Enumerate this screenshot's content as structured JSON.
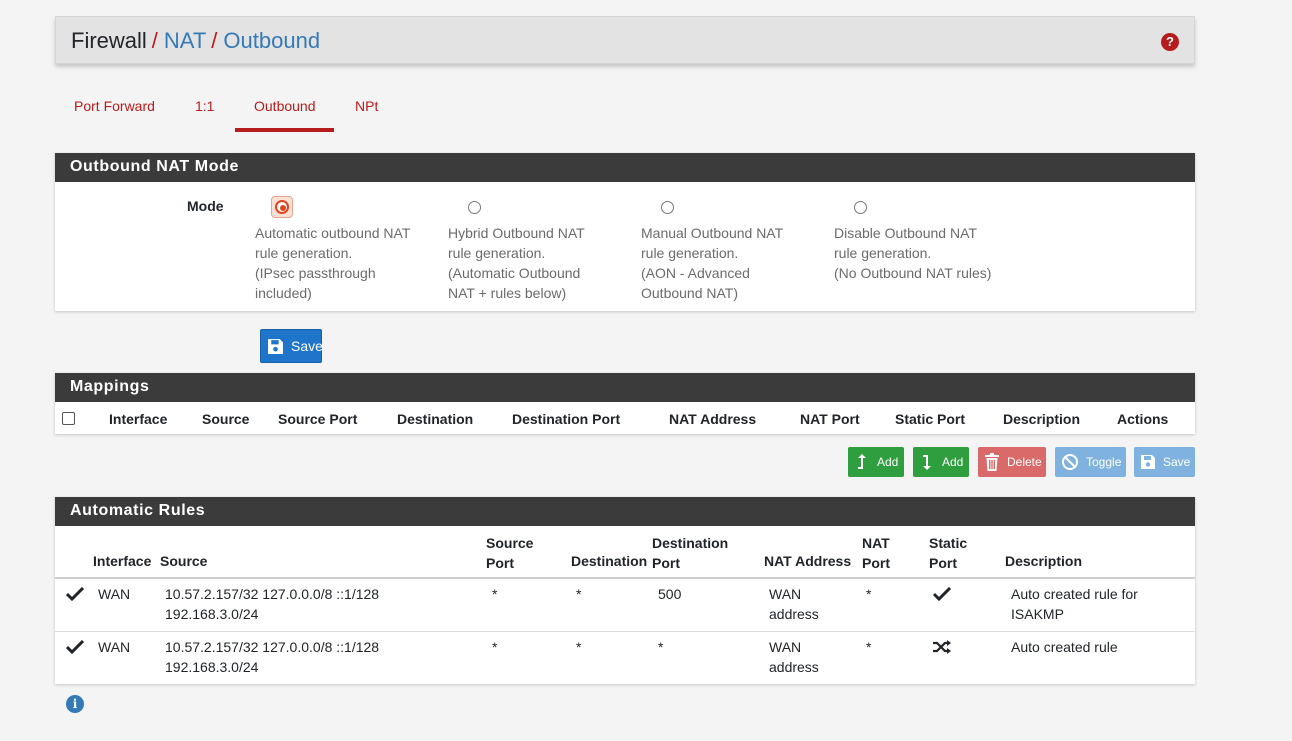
{
  "breadcrumb": {
    "items": [
      "Firewall",
      "NAT",
      "Outbound"
    ],
    "separator": "/",
    "help_icon": "question-circle-icon"
  },
  "tabs": [
    {
      "label": "Port Forward",
      "active": false
    },
    {
      "label": "1:1",
      "active": false
    },
    {
      "label": "Outbound",
      "active": true
    },
    {
      "label": "NPt",
      "active": false
    }
  ],
  "mode_panel": {
    "title": "Outbound NAT Mode",
    "field_label": "Mode",
    "options": [
      {
        "lines": [
          "Automatic outbound NAT",
          "rule generation.",
          "(IPsec passthrough",
          "included)"
        ],
        "selected": true
      },
      {
        "lines": [
          "Hybrid Outbound NAT",
          "rule generation.",
          "(Automatic Outbound",
          "NAT + rules below)"
        ],
        "selected": false
      },
      {
        "lines": [
          "Manual Outbound NAT",
          "rule generation.",
          "(AON - Advanced",
          "Outbound NAT)"
        ],
        "selected": false
      },
      {
        "lines": [
          "Disable Outbound NAT",
          "rule generation.",
          "(No Outbound NAT rules)"
        ],
        "selected": false
      }
    ],
    "save_label": "Save"
  },
  "mappings": {
    "title": "Mappings",
    "columns": [
      "Interface",
      "Source",
      "Source Port",
      "Destination",
      "Destination Port",
      "NAT Address",
      "NAT Port",
      "Static Port",
      "Description",
      "Actions"
    ],
    "buttons": {
      "add_top": "Add",
      "add_bottom": "Add",
      "delete": "Delete",
      "toggle": "Toggle",
      "save": "Save"
    }
  },
  "automatic_rules": {
    "title": "Automatic Rules",
    "columns": {
      "interface": "Interface",
      "source": "Source",
      "source_port": [
        "Source",
        "Port"
      ],
      "destination": "Destination",
      "destination_port": [
        "Destination",
        "Port"
      ],
      "nat_address": "NAT Address",
      "nat_port": [
        "NAT",
        "Port"
      ],
      "static_port": [
        "Static",
        "Port"
      ],
      "description": "Description"
    },
    "rows": [
      {
        "enabled_icon": "check-icon",
        "interface": "WAN",
        "source": [
          "10.57.2.157/32 127.0.0.0/8 ::1/128",
          "192.168.3.0/24"
        ],
        "source_port": "*",
        "destination": "*",
        "destination_port": "500",
        "nat_address": [
          "WAN",
          "address"
        ],
        "nat_port": "*",
        "static_port_icon": "check-icon",
        "description": [
          "Auto created rule for",
          "ISAKMP"
        ]
      },
      {
        "enabled_icon": "check-icon",
        "interface": "WAN",
        "source": [
          "10.57.2.157/32 127.0.0.0/8 ::1/128",
          "192.168.3.0/24"
        ],
        "source_port": "*",
        "destination": "*",
        "destination_port": "*",
        "nat_address": [
          "WAN",
          "address"
        ],
        "nat_port": "*",
        "static_port_icon": "random-icon",
        "description": [
          "Auto created rule"
        ]
      }
    ]
  },
  "footer": {
    "info_icon": "info-circle-icon"
  }
}
